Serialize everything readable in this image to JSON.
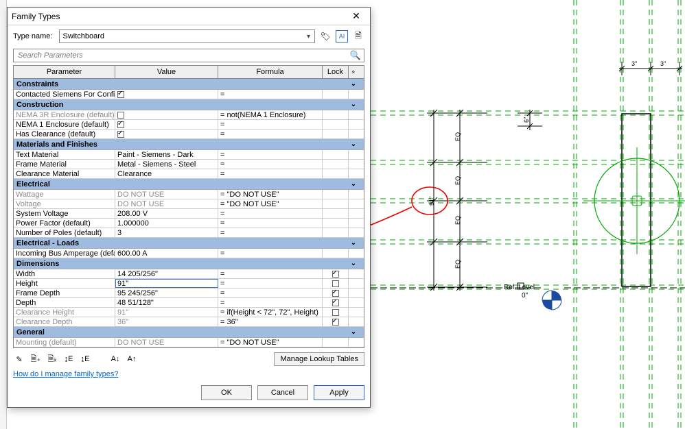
{
  "dialog": {
    "title": "Family Types",
    "type_name_label": "Type name:",
    "type_name_value": "Switchboard",
    "search_placeholder": "Search Parameters",
    "headers": {
      "parameter": "Parameter",
      "value": "Value",
      "formula": "Formula",
      "lock": "Lock"
    },
    "lookup_btn": "Manage Lookup Tables",
    "help_link": "How do I manage family types?",
    "buttons": {
      "ok": "OK",
      "cancel": "Cancel",
      "apply": "Apply"
    }
  },
  "icons": {
    "close": "✕",
    "tag": "🏷",
    "ai": "AI",
    "docnew": "🗎",
    "pencil": "✎",
    "docplus": "🗎₊",
    "docx": "🗎ₓ",
    "arrows1": "↨E",
    "arrows2": "↨E",
    "sort_az": "A↓",
    "sort_za": "A↑",
    "arrowup": "»",
    "mag": "🔍"
  },
  "sections": [
    {
      "name": "Constraints",
      "rows": [
        {
          "param": "Contacted Siemens For Configurati",
          "type": "check",
          "checked": true,
          "formula": "="
        }
      ]
    },
    {
      "name": "Construction",
      "rows": [
        {
          "param": "NEMA 3R Enclosure (default)",
          "type": "check",
          "checked": false,
          "formula": "= not(NEMA 1 Enclosure)",
          "dim": true
        },
        {
          "param": "NEMA 1 Enclosure (default)",
          "type": "check",
          "checked": true,
          "formula": "="
        },
        {
          "param": "Has Clearance (default)",
          "type": "check",
          "checked": true,
          "formula": "="
        }
      ]
    },
    {
      "name": "Materials and Finishes",
      "rows": [
        {
          "param": "Text Material",
          "value": "Paint - Siemens - Dark",
          "formula": "="
        },
        {
          "param": "Frame Material",
          "value": "Metal - Siemens - Steel",
          "formula": "="
        },
        {
          "param": "Clearance Material",
          "value": "Clearance",
          "formula": "="
        }
      ]
    },
    {
      "name": "Electrical",
      "rows": [
        {
          "param": "Wattage",
          "value": "DO NOT USE",
          "formula": "= \"DO NOT USE\"",
          "dim": true
        },
        {
          "param": "Voltage",
          "value": "DO NOT USE",
          "formula": "= \"DO NOT USE\"",
          "dim": true
        },
        {
          "param": "System Voltage",
          "value": "208.00 V",
          "formula": "="
        },
        {
          "param": "Power Factor (default)",
          "value": "1.000000",
          "formula": "="
        },
        {
          "param": "Number of Poles (default)",
          "value": "3",
          "formula": "="
        }
      ]
    },
    {
      "name": "Electrical - Loads",
      "rows": [
        {
          "param": "Incoming Bus Amperage (default)",
          "value": "600.00 A",
          "formula": "="
        }
      ]
    },
    {
      "name": "Dimensions",
      "rows": [
        {
          "param": "Width",
          "value": "14 205/256\"",
          "formula": "=",
          "lock": true
        },
        {
          "param": "Height",
          "value": "91\"",
          "formula": "=",
          "lock": false,
          "editing": true
        },
        {
          "param": "Frame Depth",
          "value": "95 245/256\"",
          "formula": "=",
          "lock": true
        },
        {
          "param": "Depth",
          "value": "48 51/128\"",
          "formula": "=",
          "lock": true
        },
        {
          "param": "Clearance Height",
          "value": "91\"",
          "formula": "= if(Height < 72\", 72\", Height)",
          "lock": false,
          "dim": true
        },
        {
          "param": "Clearance Depth",
          "value": "36\"",
          "formula": "= 36\"",
          "lock": true,
          "dim": true
        }
      ]
    },
    {
      "name": "General",
      "rows": [
        {
          "param": "Mounting (default)",
          "value": "DO NOT USE",
          "formula": "= \"DO NOT USE\"",
          "dim": true
        }
      ]
    }
  ],
  "canvas": {
    "ref_level_label": "Ref. Level",
    "ref_level_value": "0\"",
    "eq": "EQ",
    "dim_value": "91\"",
    "top_dim1": "3\"",
    "top_dim2": "3\"",
    "depth_tick": "6\""
  }
}
